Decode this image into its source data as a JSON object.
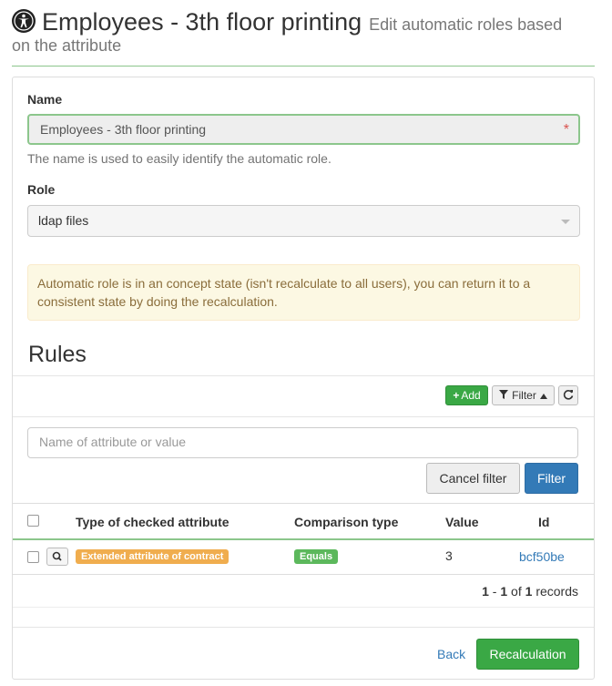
{
  "header": {
    "title": "Employees - 3th floor printing",
    "subtitle_part1": "Edit automatic roles based",
    "subtitle_part2": "on the attribute",
    "icon": "accessibility-icon"
  },
  "form": {
    "name_label": "Name",
    "name_value": "Employees - 3th floor printing",
    "required_marker": "*",
    "name_help": "The name is used to easily identify the automatic role.",
    "role_label": "Role",
    "role_value": "ldap files"
  },
  "alert": {
    "text": "Automatic role is in an concept state (isn't recalculate to all users), you can return it to a consistent state by doing the recalculation."
  },
  "rules": {
    "title": "Rules",
    "add_label": "Add",
    "filter_label": "Filter",
    "filter_placeholder": "Name of attribute or value",
    "cancel_filter_label": "Cancel filter",
    "filter_button_label": "Filter",
    "columns": {
      "type": "Type of checked attribute",
      "comparison": "Comparison type",
      "value": "Value",
      "id": "Id"
    },
    "rows": [
      {
        "type": "Extended attribute of contract",
        "comparison": "Equals",
        "value": "3",
        "id": "bcf50be"
      }
    ],
    "pager": {
      "from": "1",
      "sep": "-",
      "to": "1",
      "of": "of",
      "total": "1",
      "records": "records"
    }
  },
  "footer": {
    "back_label": "Back",
    "recalc_label": "Recalculation"
  },
  "colors": {
    "success": "#3aa845",
    "primary": "#337ab7",
    "warning": "#f0ad4e",
    "alert_bg": "#fcf8e3"
  }
}
